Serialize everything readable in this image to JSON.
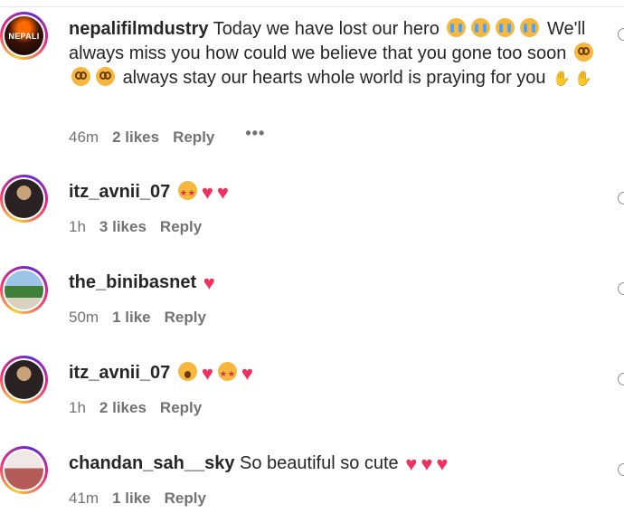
{
  "comments": [
    {
      "username": "nepalifilmdustry",
      "avatar_text": "NEPALI",
      "text_1": "Today we have lost our hero",
      "emoji_1": [
        "loudly-crying-face",
        "loudly-crying-face",
        "loudly-crying-face",
        "loudly-crying-face"
      ],
      "text_2": "We'll always miss you how could we believe that you gone too soon",
      "emoji_2": [
        "flushed-face",
        "flushed-face",
        "flushed-face"
      ],
      "text_3": "always stay our hearts whole world is praying for you",
      "emoji_3": [
        "folded-hands",
        "folded-hands"
      ],
      "time": "46m",
      "likes": "2 likes",
      "reply": "Reply",
      "more": "•••"
    },
    {
      "username": "itz_avnii_07",
      "emojis": [
        "smiling-face-with-heart-eyes",
        "heart",
        "heart"
      ],
      "time": "1h",
      "likes": "3 likes",
      "reply": "Reply"
    },
    {
      "username": "the_binibasnet",
      "emojis": [
        "heart"
      ],
      "time": "50m",
      "likes": "1 like",
      "reply": "Reply"
    },
    {
      "username": "itz_avnii_07",
      "emojis": [
        "face-with-open-mouth",
        "heart",
        "smiling-face-with-heart-eyes",
        "heart"
      ],
      "time": "1h",
      "likes": "2 likes",
      "reply": "Reply"
    },
    {
      "username": "chandan_sah__sky",
      "text": "So beautiful so cute",
      "emojis": [
        "heart",
        "heart",
        "heart"
      ],
      "time": "41m",
      "likes": "1 like",
      "reply": "Reply"
    }
  ],
  "colors": {
    "text": "#262626",
    "meta": "#737373",
    "heart": "#f0305f",
    "ring_start": "#f9ce34",
    "ring_mid": "#ee2a7b",
    "ring_end": "#6228d7"
  }
}
